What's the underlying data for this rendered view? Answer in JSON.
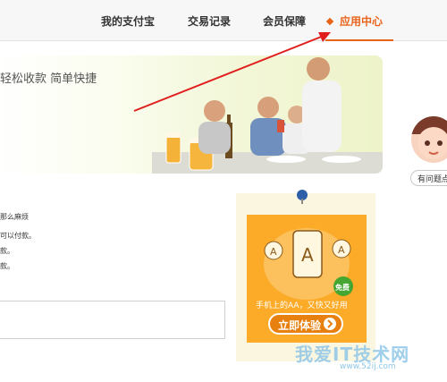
{
  "nav": {
    "items": [
      {
        "label": "我的支付宝"
      },
      {
        "label": "交易记录"
      },
      {
        "label": "会员保障"
      },
      {
        "label": "应用中心"
      }
    ],
    "active_color": "#e8641b"
  },
  "banner": {
    "slogan": "轻松收款 简单快捷"
  },
  "help": {
    "bubble_text": "有问题点"
  },
  "info": {
    "lines": [
      "那么麻烦",
      "可以付款。",
      "款。",
      "款。"
    ]
  },
  "promo": {
    "caption": "手机上的AA，又快又好用",
    "badge": "免费",
    "button_label": "立即体验",
    "bg_color": "#fbab27"
  },
  "watermark": {
    "text": "我爱IT技术网",
    "sub": "www.52ij.com"
  },
  "annotation": {
    "arrow_color": "#e01e1e"
  }
}
